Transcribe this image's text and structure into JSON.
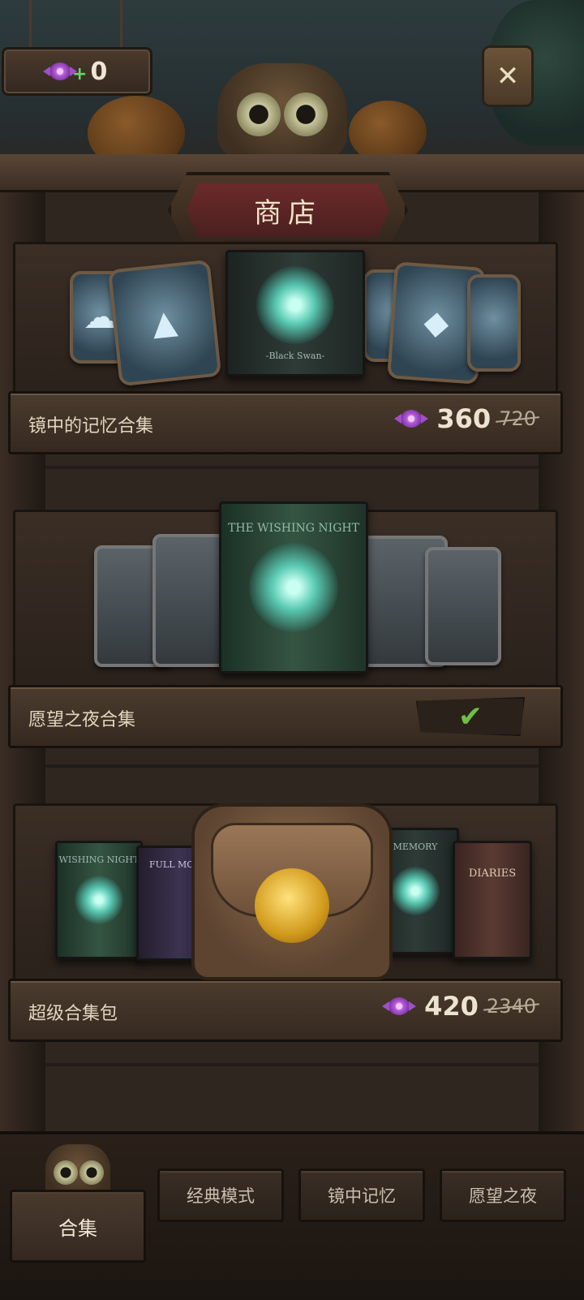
{
  "currency": {
    "icon": "candy-icon",
    "plus": "+",
    "amount": "0"
  },
  "close_button": {
    "label": "✕"
  },
  "title": "商店",
  "bundles": [
    {
      "name": "镜中的记忆合集",
      "price": "360",
      "original_price": "720",
      "currency_icon": "candy-icon",
      "owned": false,
      "book_label": "-Black Swan-"
    },
    {
      "name": "愿望之夜合集",
      "owned": true,
      "status_icon": "checkmark-icon",
      "book_label": "THE WISHING NIGHT"
    },
    {
      "name": "超级合集包",
      "price": "420",
      "original_price": "2340",
      "currency_icon": "candy-icon",
      "owned": false,
      "book_labels": [
        "WISHING NIGHT",
        "FULL MOON",
        "MEMORY",
        "DIARIES"
      ]
    }
  ],
  "tabs": [
    {
      "label": "合集",
      "active": true
    },
    {
      "label": "经典模式",
      "active": false
    },
    {
      "label": "镜中记忆",
      "active": false
    },
    {
      "label": "愿望之夜",
      "active": false
    }
  ],
  "colors": {
    "price_text": "#ece3d0",
    "check": "#6fbf46",
    "candy": "#b560d8",
    "title_banner": "#6b2b2a"
  }
}
